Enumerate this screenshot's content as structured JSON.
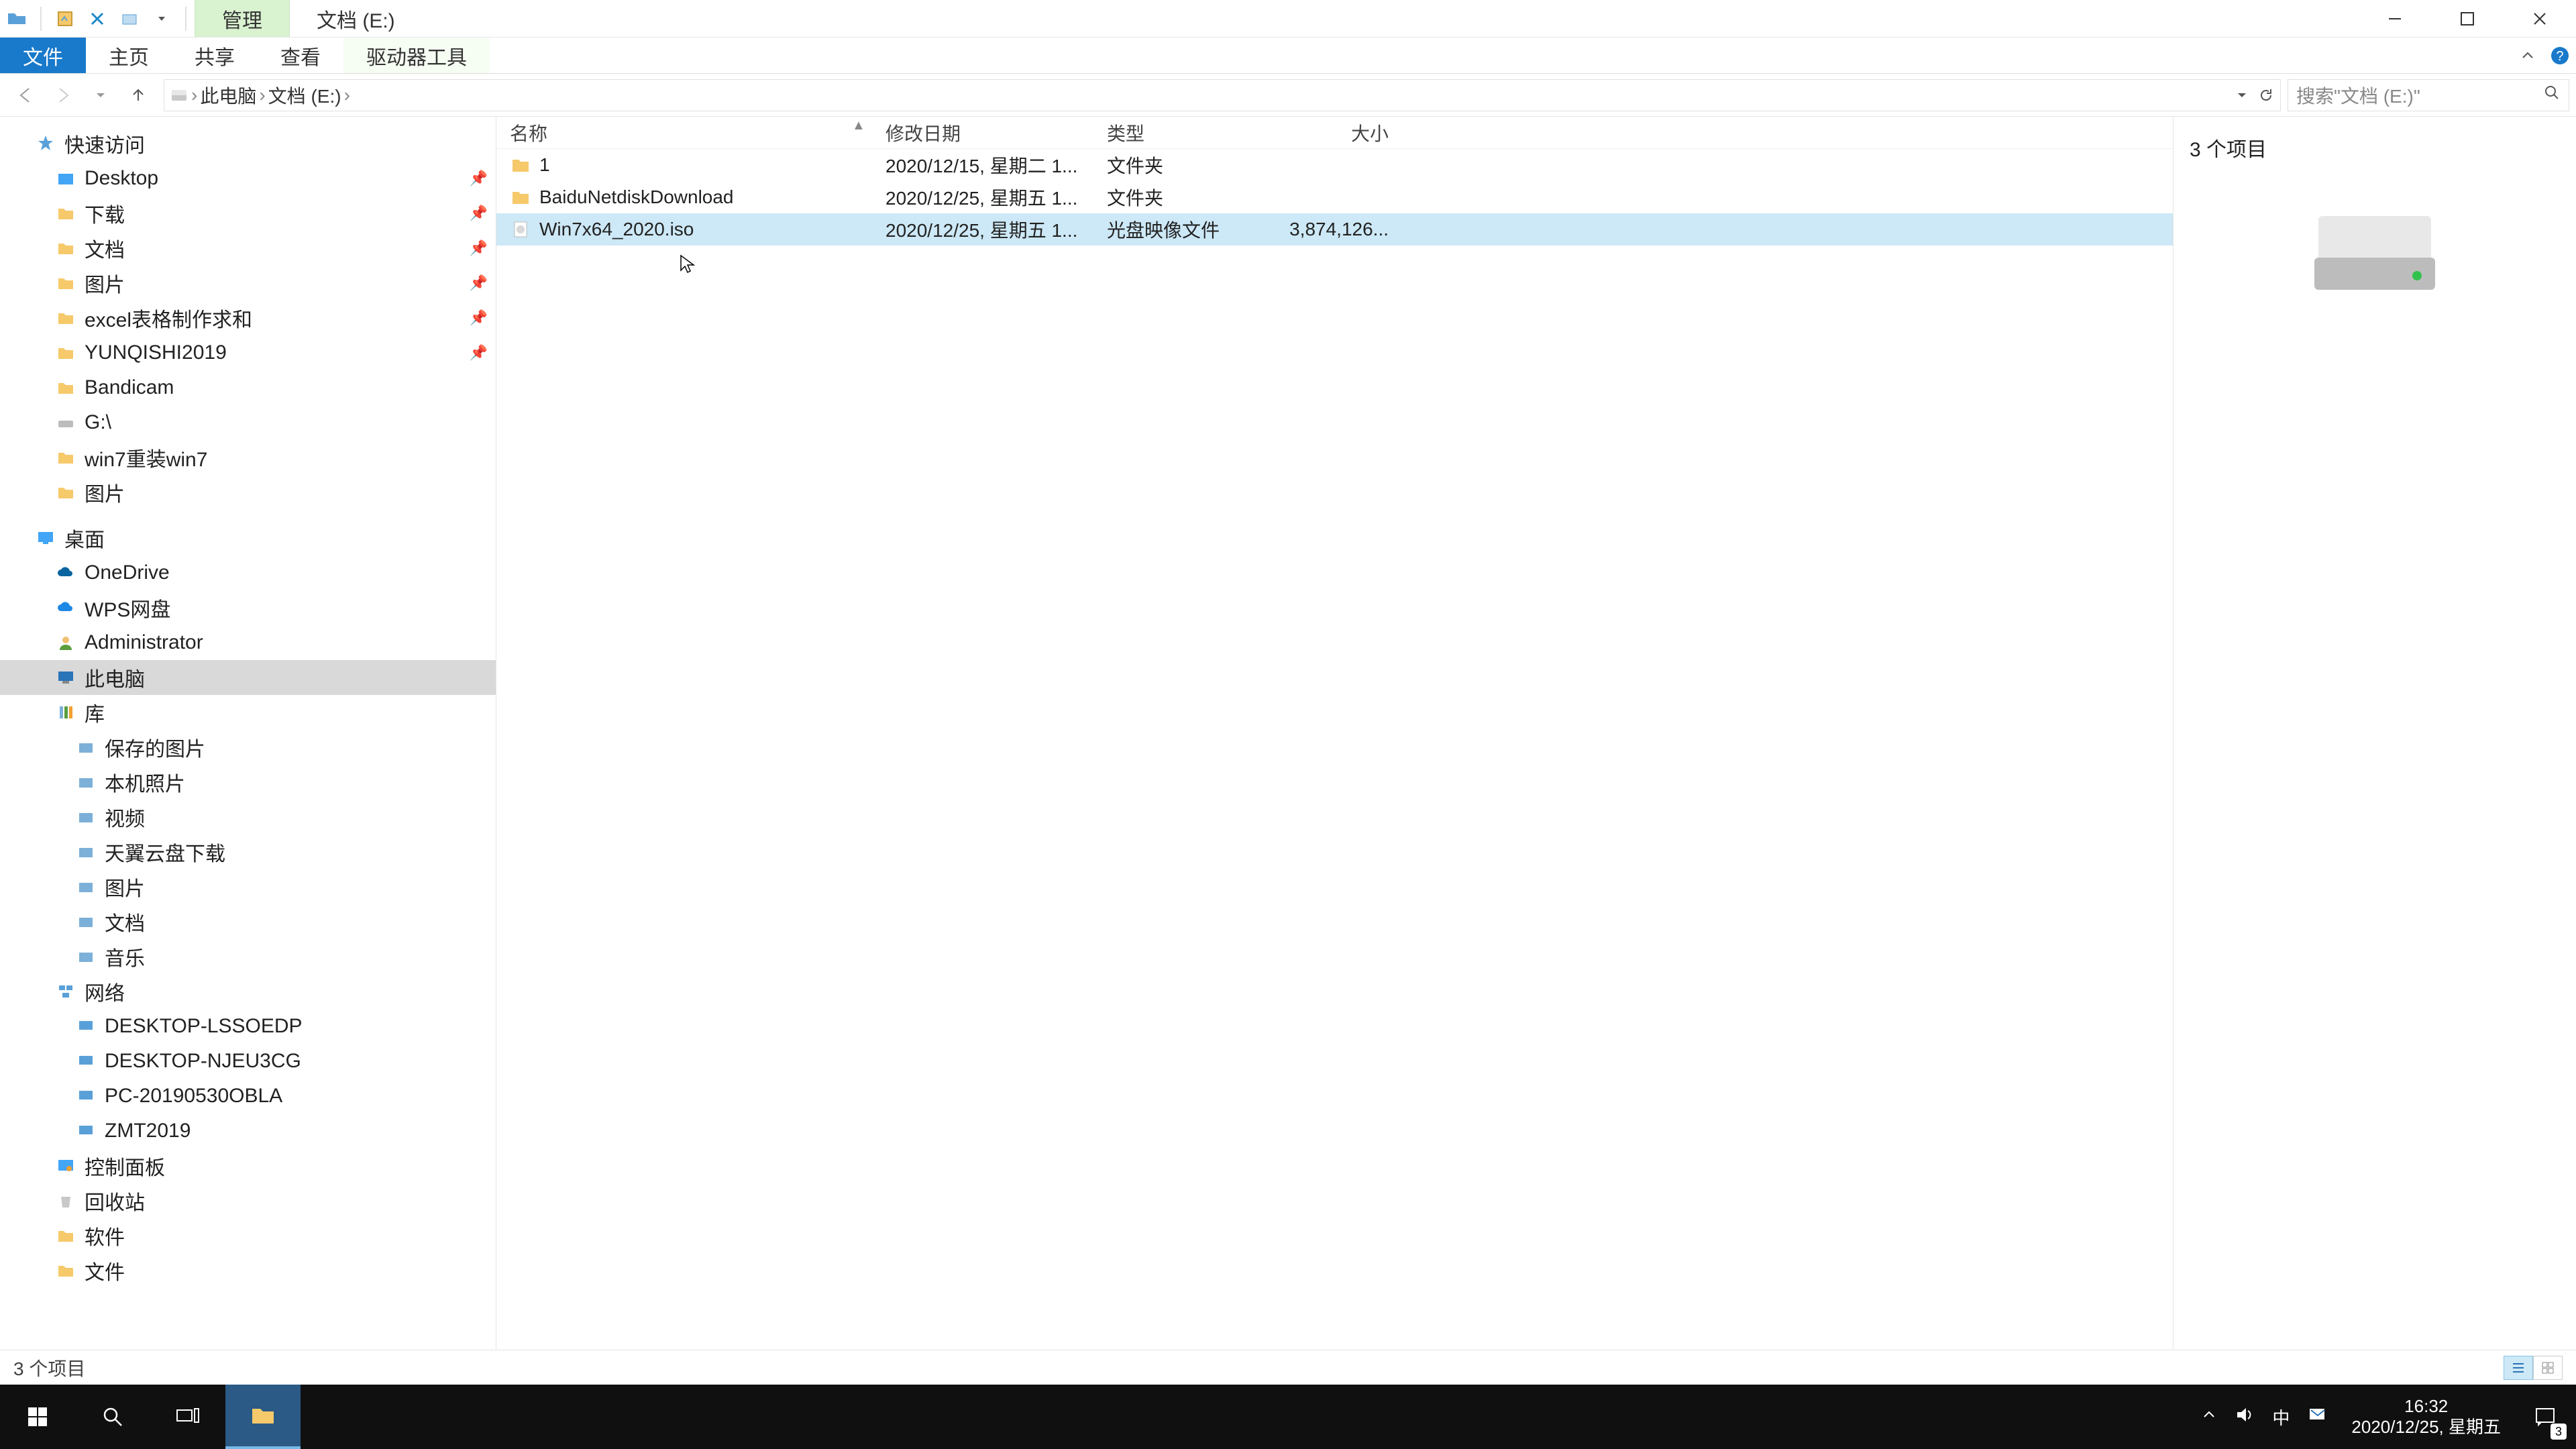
{
  "title": {
    "ribbon_hint": "管理",
    "location": "文档 (E:)"
  },
  "menu": {
    "file": "文件",
    "home": "主页",
    "share": "共享",
    "view": "查看",
    "drive_tools": "驱动器工具"
  },
  "breadcrumbs": {
    "root": "此电脑",
    "current": "文档 (E:)"
  },
  "search": {
    "placeholder": "搜索\"文档 (E:)\""
  },
  "tree": {
    "quick_access": "快速访问",
    "desktop": "Desktop",
    "downloads": "下载",
    "documents": "文档",
    "pictures": "图片",
    "excel_req": "excel表格制作求和",
    "yunqishi": "YUNQISHI2019",
    "bandicam": "Bandicam",
    "g_drive": "G:\\",
    "win7reinstall": "win7重装win7",
    "pictures2": "图片",
    "desktop_cn": "桌面",
    "onedrive": "OneDrive",
    "wps": "WPS网盘",
    "admin": "Administrator",
    "this_pc": "此电脑",
    "libraries": "库",
    "saved_pics": "保存的图片",
    "local_photos": "本机照片",
    "videos": "视频",
    "tianyi": "天翼云盘下载",
    "pictures3": "图片",
    "documents2": "文档",
    "music": "音乐",
    "network": "网络",
    "pc_lssoedp": "DESKTOP-LSSOEDP",
    "pc_njeu3cg": "DESKTOP-NJEU3CG",
    "pc_2019": "PC-20190530OBLA",
    "zmt2019": "ZMT2019",
    "control_panel": "控制面板",
    "recycle_bin": "回收站",
    "software": "软件",
    "folder_file": "文件"
  },
  "columns": {
    "name": "名称",
    "date": "修改日期",
    "type": "类型",
    "size": "大小"
  },
  "files": [
    {
      "name": "1",
      "date": "2020/12/15, 星期二 1...",
      "type": "文件夹",
      "size": "",
      "icon": "folder"
    },
    {
      "name": "BaiduNetdiskDownload",
      "date": "2020/12/25, 星期五 1...",
      "type": "文件夹",
      "size": "",
      "icon": "folder"
    },
    {
      "name": "Win7x64_2020.iso",
      "date": "2020/12/25, 星期五 1...",
      "type": "光盘映像文件",
      "size": "3,874,126...",
      "icon": "iso"
    }
  ],
  "preview": {
    "count_text": "3 个项目"
  },
  "statusbar": {
    "text": "3 个项目"
  },
  "tray": {
    "ime": "中"
  },
  "clock": {
    "time": "16:32",
    "date": "2020/12/25, 星期五"
  },
  "notif": {
    "badge": "3"
  }
}
